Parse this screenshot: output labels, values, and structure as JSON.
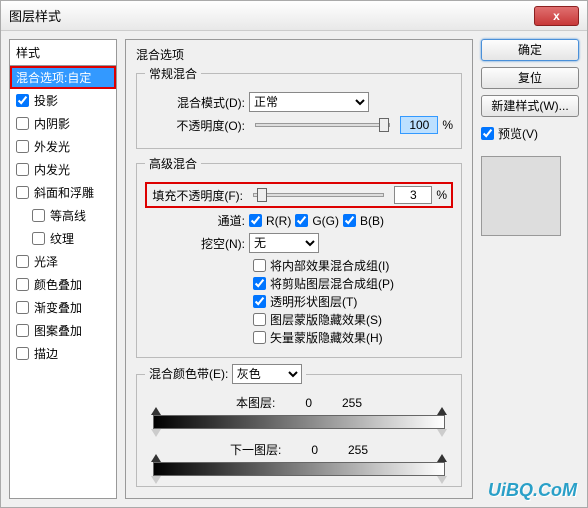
{
  "window": {
    "title": "图层样式",
    "close": "x"
  },
  "left": {
    "header": "样式",
    "selected": "混合选项:自定",
    "items": [
      {
        "label": "投影",
        "checked": true
      },
      {
        "label": "内阴影",
        "checked": false
      },
      {
        "label": "外发光",
        "checked": false
      },
      {
        "label": "内发光",
        "checked": false
      },
      {
        "label": "斜面和浮雕",
        "checked": false
      },
      {
        "label": "等高线",
        "checked": false,
        "indent": true
      },
      {
        "label": "纹理",
        "checked": false,
        "indent": true
      },
      {
        "label": "光泽",
        "checked": false
      },
      {
        "label": "颜色叠加",
        "checked": false
      },
      {
        "label": "渐变叠加",
        "checked": false
      },
      {
        "label": "图案叠加",
        "checked": false
      },
      {
        "label": "描边",
        "checked": false
      }
    ]
  },
  "center": {
    "title": "混合选项",
    "group1": {
      "legend": "常规混合",
      "blendModeLabel": "混合模式(D):",
      "blendModeValue": "正常",
      "opacityLabel": "不透明度(O):",
      "opacityValue": "100",
      "percent": "%"
    },
    "group2": {
      "legend": "高级混合",
      "fillOpacityLabel": "填充不透明度(F):",
      "fillOpacityValue": "3",
      "percent": "%",
      "channelsLabel": "通道:",
      "chR": "R(R)",
      "chG": "G(G)",
      "chB": "B(B)",
      "knockoutLabel": "挖空(N):",
      "knockoutValue": "无",
      "opts": [
        {
          "label": "将内部效果混合成组(I)",
          "checked": false
        },
        {
          "label": "将剪贴图层混合成组(P)",
          "checked": true
        },
        {
          "label": "透明形状图层(T)",
          "checked": true
        },
        {
          "label": "图层蒙版隐藏效果(S)",
          "checked": false
        },
        {
          "label": "矢量蒙版隐藏效果(H)",
          "checked": false
        }
      ]
    },
    "group3": {
      "legend": "混合颜色带(E):",
      "bandValue": "灰色",
      "thisLayer": "本图层:",
      "nextLayer": "下一图层:",
      "v0": "0",
      "v255": "255"
    }
  },
  "right": {
    "ok": "确定",
    "reset": "复位",
    "newStyle": "新建样式(W)...",
    "previewLabel": "预览(V)"
  },
  "watermark": "UiBQ.CoM"
}
